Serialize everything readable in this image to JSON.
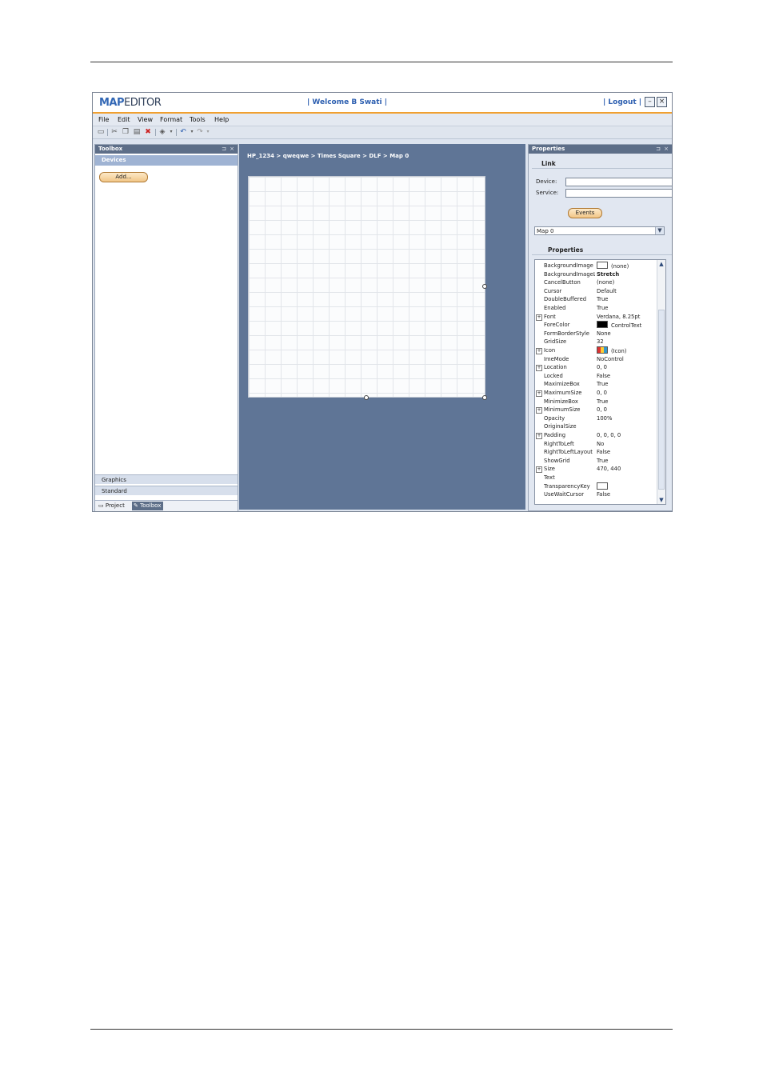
{
  "app": {
    "logo_part1": "MAP",
    "logo_part2": "EDITOR",
    "welcome": "| Welcome  B Swati  |",
    "logout": "| Logout |",
    "minimize_glyph": "–",
    "close_glyph": "×"
  },
  "menu": [
    "File",
    "Edit",
    "View",
    "Format",
    "Tools",
    "Help"
  ],
  "toolbar_icons": [
    "save-icon",
    "cut-icon",
    "copy-icon",
    "paste-icon",
    "delete-icon",
    "format-icon",
    "undo-icon",
    "redo-icon"
  ],
  "toolbox": {
    "title": "Toolbox",
    "pin": "⊐",
    "close": "×",
    "section": "Devices",
    "add_button": "Add...",
    "categories": [
      "Graphics",
      "Standard"
    ],
    "tabs": [
      "Project",
      "Toolbox"
    ]
  },
  "design": {
    "breadcrumb": "HP_1234 > qweqwe > Times Square > DLF > Map 0"
  },
  "properties_panel": {
    "title": "Properties",
    "pin": "⊐",
    "close": "×",
    "link_title": "Link",
    "device_label": "Device:",
    "service_label": "Service:",
    "events_button": "Events",
    "selected_object": "Map 0",
    "section_title": "Properties",
    "rows": [
      {
        "name": "BackgroundImage",
        "value": "(none)",
        "swatch": "white"
      },
      {
        "name": "BackgroundImageLayout",
        "value": "Stretch",
        "bold": true
      },
      {
        "name": "CancelButton",
        "value": "(none)"
      },
      {
        "name": "Cursor",
        "value": "Default"
      },
      {
        "name": "DoubleBuffered",
        "value": "True"
      },
      {
        "name": "Enabled",
        "value": "True"
      },
      {
        "name": "Font",
        "value": "Verdana, 8.25pt",
        "expand": true
      },
      {
        "name": "ForeColor",
        "value": "ControlText",
        "swatch": "black"
      },
      {
        "name": "FormBorderStyle",
        "value": "None"
      },
      {
        "name": "GridSize",
        "value": "32"
      },
      {
        "name": "Icon",
        "value": "(Icon)",
        "expand": true,
        "swatch": "icon"
      },
      {
        "name": "ImeMode",
        "value": "NoControl"
      },
      {
        "name": "Location",
        "value": "0, 0",
        "expand": true
      },
      {
        "name": "Locked",
        "value": "False"
      },
      {
        "name": "MaximizeBox",
        "value": "True"
      },
      {
        "name": "MaximumSize",
        "value": "0, 0",
        "expand": true
      },
      {
        "name": "MinimizeBox",
        "value": "True"
      },
      {
        "name": "MinimumSize",
        "value": "0, 0",
        "expand": true
      },
      {
        "name": "Opacity",
        "value": "100%"
      },
      {
        "name": "OriginalSize",
        "value": ""
      },
      {
        "name": "Padding",
        "value": "0, 0, 0, 0",
        "expand": true
      },
      {
        "name": "RightToLeft",
        "value": "No"
      },
      {
        "name": "RightToLeftLayout",
        "value": "False"
      },
      {
        "name": "ShowGrid",
        "value": "True"
      },
      {
        "name": "Size",
        "value": "470, 440",
        "expand": true
      },
      {
        "name": "Text",
        "value": ""
      },
      {
        "name": "TransparencyKey",
        "value": "",
        "swatch": "white"
      },
      {
        "name": "UseWaitCursor",
        "value": "False"
      }
    ]
  }
}
